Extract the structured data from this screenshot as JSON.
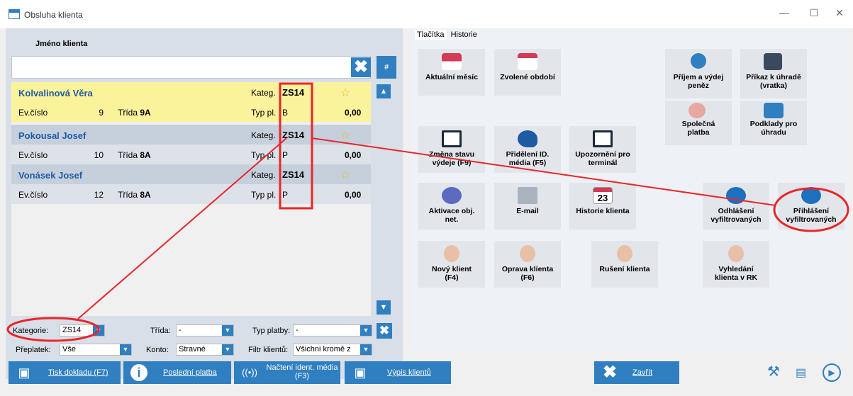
{
  "window": {
    "title": "Obsluha klienta",
    "minimize": "—",
    "maximize": "☐",
    "close": "✕"
  },
  "left": {
    "client_name_label": "Jméno klienta",
    "search_value": "",
    "clear_icon": "✖",
    "hash_label": "#",
    "up_icon": "▲",
    "down_icon": "▼",
    "records": [
      {
        "name": "Kolvalinová Věra",
        "kat_label": "Kateg.",
        "kat": "ZS14",
        "ev_label": "Ev.číslo",
        "ev": "9",
        "tr_label": "Třída",
        "tr": "9A",
        "typ_label": "Typ pl.",
        "typ": "B",
        "amount": "0,00",
        "highlight": true
      },
      {
        "name": "Pokousal Josef",
        "kat_label": "Kateg.",
        "kat": "ZS14",
        "ev_label": "Ev.číslo",
        "ev": "10",
        "tr_label": "Třída",
        "tr": "8A",
        "typ_label": "Typ pl.",
        "typ": "P",
        "amount": "0,00",
        "highlight": false
      },
      {
        "name": "Vonásek Josef",
        "kat_label": "Kateg.",
        "kat": "ZS14",
        "ev_label": "Ev.číslo",
        "ev": "12",
        "tr_label": "Třída",
        "tr": "8A",
        "typ_label": "Typ pl.",
        "typ": "P",
        "amount": "0,00",
        "highlight": false
      }
    ],
    "filters": {
      "kategorie_label": "Kategorie:",
      "kategorie": "ZS14",
      "trida_label": "Třída:",
      "trida": "-",
      "typ_platby_label": "Typ platby:",
      "typ_platby": "-",
      "preplatek_label": "Přeplatek:",
      "preplatek": "Vše",
      "konto_label": "Konto:",
      "konto": "Stravné",
      "filtr_label": "Filtr klientů:",
      "filtr": "Všichni kromě z"
    }
  },
  "tabs": [
    "Tlačítka",
    "Historie"
  ],
  "tiles": {
    "aktualni": "Aktuální měsíc",
    "zvolene": "Zvolené období",
    "prijem1": "Příjem a výdej",
    "prijem2": "peněz",
    "prikaz1": "Příkaz k úhradě",
    "prikaz2": "(vratka)",
    "spolecna1": "Společná",
    "spolecna2": "platba",
    "podklady1": "Podklady pro",
    "podklady2": "úhradu",
    "zmena1": "Změna stavu",
    "zmena2": "výdeje (F9)",
    "prideleni1": "Přidělení ID.",
    "prideleni2": "média (F5)",
    "upozorneni1": "Upozornění pro",
    "upozorneni2": "terminál",
    "aktivace1": "Aktivace obj.",
    "aktivace2": "net.",
    "email": "E-mail",
    "historie": "Historie klienta",
    "odhlaseni1": "Odhlášení",
    "odhlaseni2": "vyfiltrovaných",
    "prihlaseni1": "Přihlášení",
    "prihlaseni2": "vyfiltrovaných",
    "novy1": "Nový klient",
    "novy2": "(F4)",
    "oprava1": "Oprava klienta",
    "oprava2": "(F6)",
    "ruseni": "Rušení klienta",
    "vyhledani1": "Vyhledání",
    "vyhledani2": "klienta v RK",
    "calendar_day": "23"
  },
  "bottom": {
    "tisk": "Tisk dokladu (F7)",
    "posledni": "Poslední platba",
    "nacteni1": "Načtení ident. média",
    "nacteni2": "(F3)",
    "vypis": "Výpis klientů",
    "zavrit": "Zavřít",
    "tools_icon": "⚒",
    "book_icon": "📖",
    "play_icon": "▶"
  },
  "colors": {
    "accent": "#2f7fc1",
    "highlight_row": "#fbf39b",
    "annotation": "#e8262a"
  }
}
